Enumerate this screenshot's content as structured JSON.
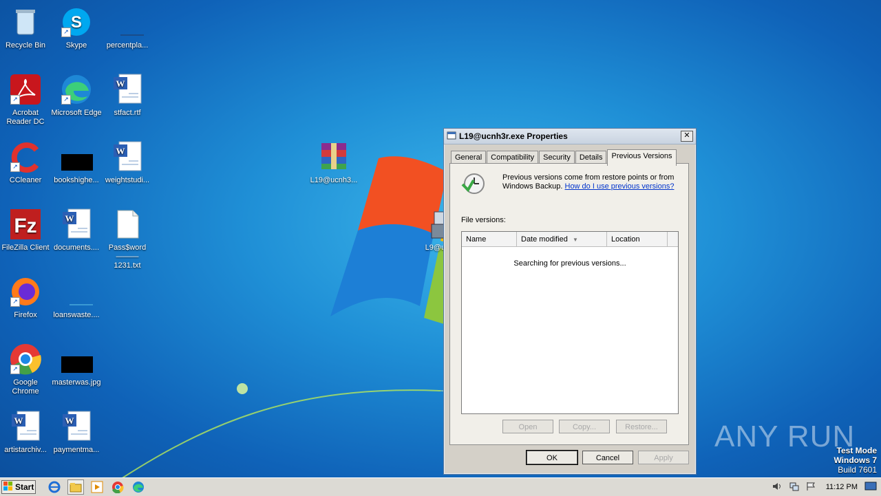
{
  "desktop": {
    "icons": [
      {
        "label": "Recycle Bin"
      },
      {
        "label": "Skype"
      },
      {
        "label": "percentpla..."
      },
      {
        "label": "Acrobat Reader DC"
      },
      {
        "label": "Microsoft Edge"
      },
      {
        "label": "stfact.rtf"
      },
      {
        "label": "CCleaner"
      },
      {
        "label": "bookshighe..."
      },
      {
        "label": "weightstudi..."
      },
      {
        "label": "L19@ucnh3..."
      },
      {
        "label": "FileZilla Client"
      },
      {
        "label": "documents...."
      },
      {
        "label": "Pass$word ——— 1231.txt"
      },
      {
        "label": "Firefox"
      },
      {
        "label": "loanswaste...."
      },
      {
        "label": "Google Chrome"
      },
      {
        "label": "masterwas.jpg"
      },
      {
        "label": "artistarchiv..."
      },
      {
        "label": "paymentma..."
      },
      {
        "label": "L9@ucr"
      }
    ]
  },
  "dialog": {
    "title": "L19@ucnh3r.exe Properties",
    "close_glyph": "✕",
    "tabs": [
      "General",
      "Compatibility",
      "Security",
      "Details",
      "Previous Versions"
    ],
    "active_tab": "Previous Versions",
    "info_text": "Previous versions come from restore points or from Windows Backup.",
    "info_link": "How do I use previous versions?",
    "file_versions_label": "File versions:",
    "columns": [
      "Name",
      "Date modified",
      "Location"
    ],
    "empty_message": "Searching for previous versions...",
    "buttons": {
      "open": "Open",
      "copy": "Copy...",
      "restore": "Restore..."
    },
    "footer": {
      "ok": "OK",
      "cancel": "Cancel",
      "apply": "Apply"
    }
  },
  "taskbar": {
    "start_label": "Start",
    "clock": "11:12 PM"
  },
  "watermark": {
    "line1": "Test Mode",
    "line2": "Windows 7",
    "line3": "Build 7601",
    "brand": "ANY RUN"
  }
}
